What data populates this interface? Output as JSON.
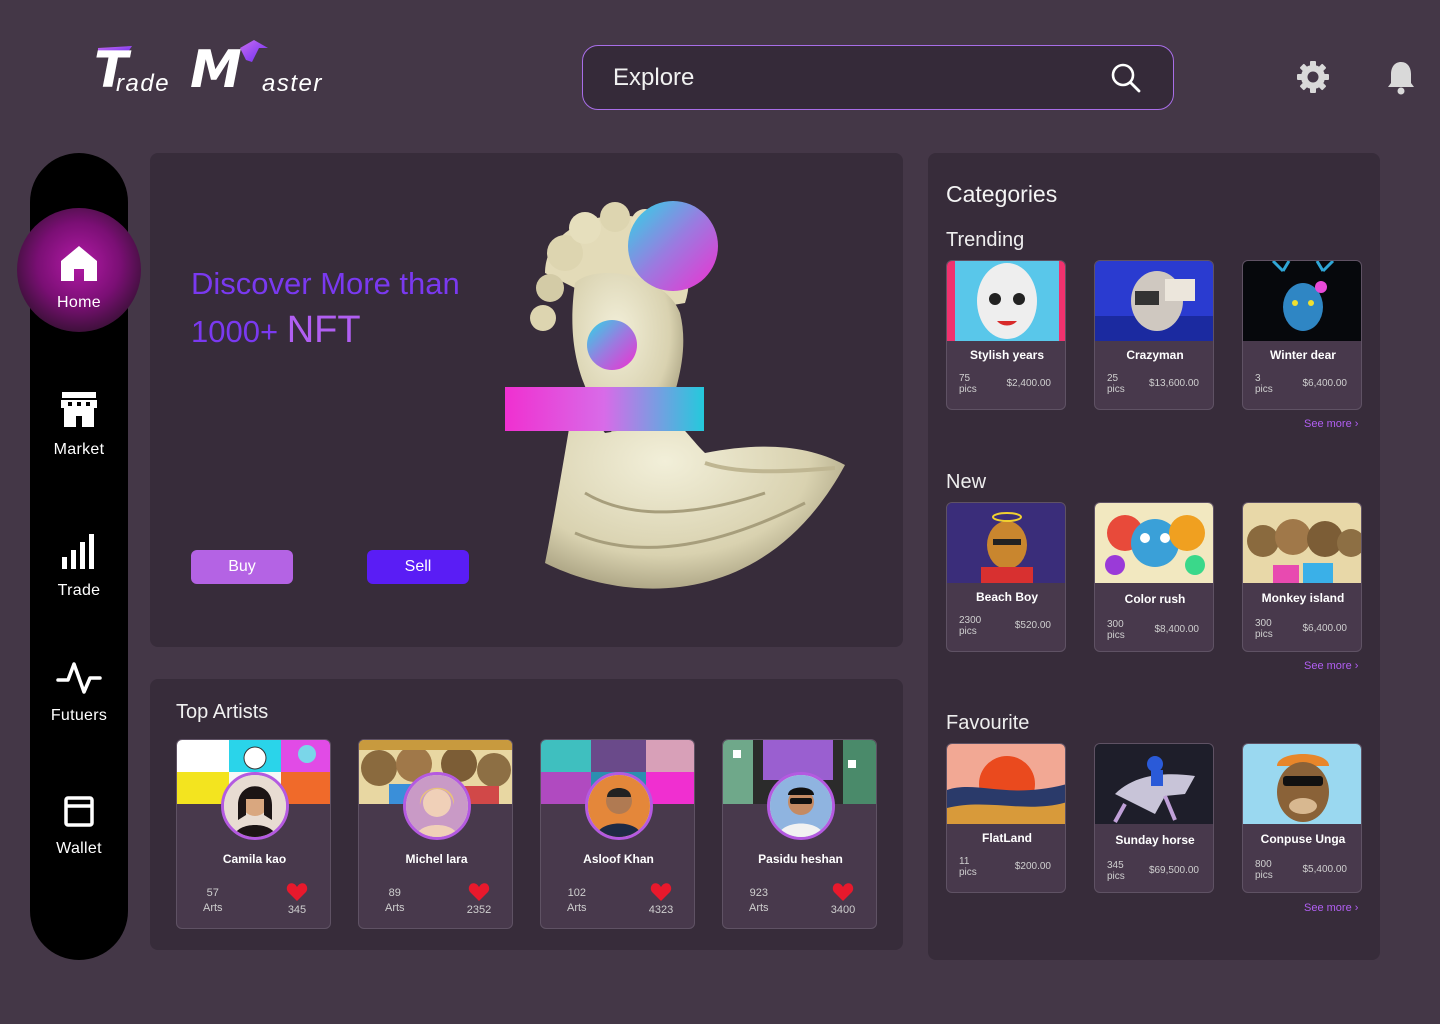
{
  "brand": {
    "logo_first": "T",
    "logo_first_rest": "rade",
    "logo_second": "M",
    "logo_second_rest": "aster"
  },
  "search": {
    "placeholder": "Explore"
  },
  "sidebar": {
    "items": [
      {
        "label": "Home",
        "icon": "home-icon",
        "active": true
      },
      {
        "label": "Market",
        "icon": "store-icon"
      },
      {
        "label": "Trade",
        "icon": "bar-chart-icon"
      },
      {
        "label": "Futuers",
        "icon": "pulse-icon"
      },
      {
        "label": "Wallet",
        "icon": "wallet-icon"
      }
    ]
  },
  "hero": {
    "line1": "Discover More than",
    "line2_prefix": "1000+ ",
    "line2_highlight": "NFT",
    "buy_label": "Buy",
    "sell_label": "Sell"
  },
  "top_artists": {
    "title": "Top Artists",
    "artists": [
      {
        "name": "Camila kao",
        "arts": "57",
        "arts_label": "Arts",
        "likes": "345"
      },
      {
        "name": "Michel lara",
        "arts": "89",
        "arts_label": "Arts",
        "likes": "2352"
      },
      {
        "name": "Asloof Khan",
        "arts": "102",
        "arts_label": "Arts",
        "likes": "4323"
      },
      {
        "name": "Pasidu heshan",
        "arts": "923",
        "arts_label": "Arts",
        "likes": "3400"
      }
    ]
  },
  "categories": {
    "title": "Categories",
    "see_more": "See more",
    "sections": [
      {
        "title": "Trending",
        "items": [
          {
            "name": "Stylish years",
            "pics": "75",
            "pics_label": "pics",
            "price": "$2,400.00"
          },
          {
            "name": "Crazyman",
            "pics": "25",
            "pics_label": "pics",
            "price": "$13,600.00"
          },
          {
            "name": "Winter dear",
            "pics": "3",
            "pics_label": "pics",
            "price": "$6,400.00"
          }
        ]
      },
      {
        "title": "New",
        "items": [
          {
            "name": "Beach Boy",
            "pics": "2300",
            "pics_label": "pics",
            "price": "$520.00"
          },
          {
            "name": "Color rush",
            "pics": "300",
            "pics_label": "pics",
            "price": "$8,400.00"
          },
          {
            "name": "Monkey island",
            "pics": "300",
            "pics_label": "pics",
            "price": "$6,400.00"
          }
        ]
      },
      {
        "title": "Favourite",
        "items": [
          {
            "name": "FlatLand",
            "pics": "11",
            "pics_label": "pics",
            "price": "$200.00"
          },
          {
            "name": "Sunday horse",
            "pics": "345",
            "pics_label": "pics",
            "price": "$69,500.00"
          },
          {
            "name": "Conpuse Unga",
            "pics": "800",
            "pics_label": "pics",
            "price": "$5,400.00"
          }
        ]
      }
    ]
  },
  "colors": {
    "background": "#443747",
    "panel": "#372c3a",
    "accent": "#b15ff2",
    "primary": "#5a1df5",
    "like": "#e8192c"
  }
}
